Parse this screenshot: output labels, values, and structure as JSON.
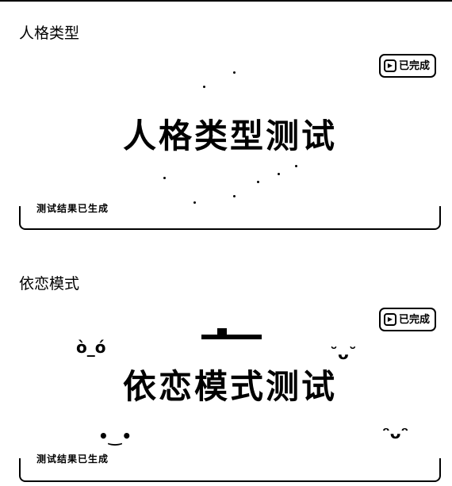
{
  "sections": [
    {
      "title": "人格类型",
      "card": {
        "badge_label": "已完成",
        "headline": "人格类型测试",
        "caption": "测试结果已生成"
      }
    },
    {
      "title": "依恋模式",
      "card": {
        "badge_label": "已完成",
        "headline": "依恋模式测试",
        "caption": "测试结果已生成"
      }
    }
  ],
  "decorations": {
    "face_1": "ò_ó",
    "face_2": "˘ᴗ˘",
    "face_3": "•‿•",
    "face_4": "ᵔᴗᵔ"
  }
}
